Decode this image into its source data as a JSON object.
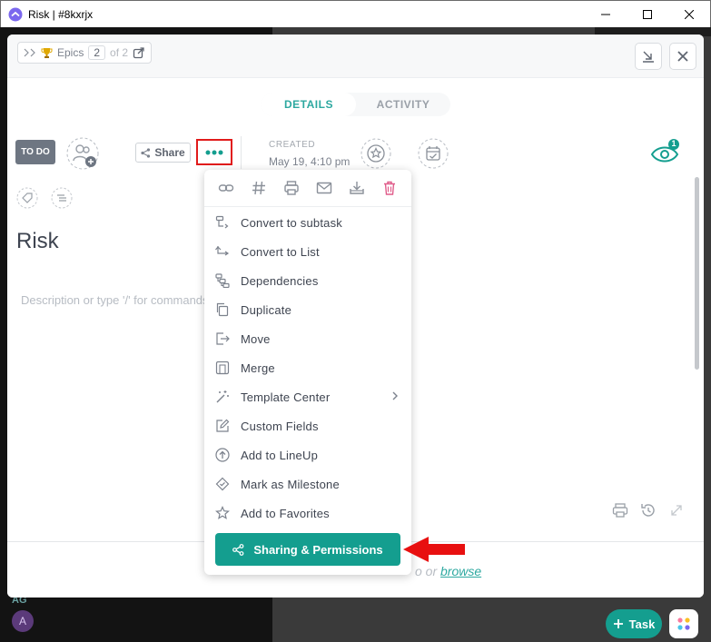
{
  "window": {
    "title": "Risk | #8kxrjx"
  },
  "breadcrumb": {
    "label": "Epics",
    "current": "2",
    "of_text": "of 2"
  },
  "tabs": [
    {
      "label": "DETAILS",
      "active": true
    },
    {
      "label": "ACTIVITY",
      "active": false
    }
  ],
  "toolbar": {
    "status": "TO DO",
    "share_label": "Share",
    "created_label": "CREATED",
    "created_value": "May 19, 4:10 pm",
    "watchers_count": "1"
  },
  "task": {
    "title": "Risk",
    "description_placeholder": "Description or type '/' for commands"
  },
  "menu": {
    "icon_row": [
      "link-icon",
      "hash-icon",
      "print-icon",
      "mail-icon",
      "download-icon",
      "trash-icon"
    ],
    "items": [
      {
        "label": "Convert to subtask",
        "icon": "subtask-icon"
      },
      {
        "label": "Convert to List",
        "icon": "list-convert-icon"
      },
      {
        "label": "Dependencies",
        "icon": "dependencies-icon"
      },
      {
        "label": "Duplicate",
        "icon": "duplicate-icon"
      },
      {
        "label": "Move",
        "icon": "move-icon"
      },
      {
        "label": "Merge",
        "icon": "merge-icon"
      },
      {
        "label": "Template Center",
        "icon": "wand-icon",
        "submenu": true
      },
      {
        "label": "Custom Fields",
        "icon": "edit-icon"
      },
      {
        "label": "Add to LineUp",
        "icon": "arrow-up-circle-icon"
      },
      {
        "label": "Mark as Milestone",
        "icon": "diamond-icon"
      },
      {
        "label": "Add to Favorites",
        "icon": "star-icon"
      }
    ],
    "primary_label": "Sharing & Permissions"
  },
  "attachments": {
    "text": "o or",
    "link": "browse"
  },
  "sidebar": {
    "avatar_initials": "AG",
    "avatar_letter": "A"
  },
  "fab": {
    "task_label": "Task"
  },
  "colors": {
    "accent": "#149e8f",
    "highlight": "#e11b1b",
    "danger": "#e05c8a"
  }
}
